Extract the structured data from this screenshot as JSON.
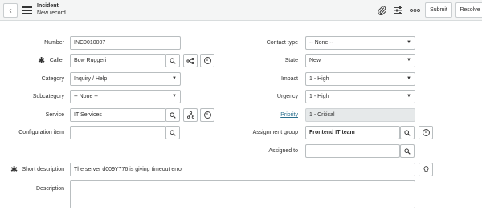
{
  "header": {
    "title": "Incident",
    "subtitle": "New record",
    "back_icon": "chevron-left-icon",
    "menu_icon": "hamburger-menu-icon",
    "attach_icon": "paperclip-icon",
    "settings_icon": "sliders-icon",
    "more_icon": "more-icon",
    "submit_label": "Submit",
    "resolve_label": "Resolve"
  },
  "form": {
    "number": {
      "label": "Number",
      "value": "INC0010007"
    },
    "caller": {
      "label": "Caller",
      "value": "Bow Ruggeri"
    },
    "category": {
      "label": "Category",
      "value": "Inquiry / Help"
    },
    "subcategory": {
      "label": "Subcategory",
      "value": "-- None --"
    },
    "service": {
      "label": "Service",
      "value": "IT Services"
    },
    "configuration_item": {
      "label": "Configuration item",
      "value": ""
    },
    "short_description": {
      "label": "Short description",
      "value": "The server d009Y776 is giving timeout error"
    },
    "description": {
      "label": "Description",
      "value": ""
    },
    "contact_type": {
      "label": "Contact type",
      "value": "-- None --"
    },
    "state": {
      "label": "State",
      "value": "New"
    },
    "impact": {
      "label": "Impact",
      "value": "1 - High"
    },
    "urgency": {
      "label": "Urgency",
      "value": "1 - High"
    },
    "priority": {
      "label": "Priority",
      "value": "1 - Critical"
    },
    "assignment_group": {
      "label": "Assignment group",
      "value": "Frontend IT team"
    },
    "assigned_to": {
      "label": "Assigned to",
      "value": ""
    }
  },
  "glyphs": {
    "required": "✱",
    "caret": "▼",
    "info": "i"
  }
}
